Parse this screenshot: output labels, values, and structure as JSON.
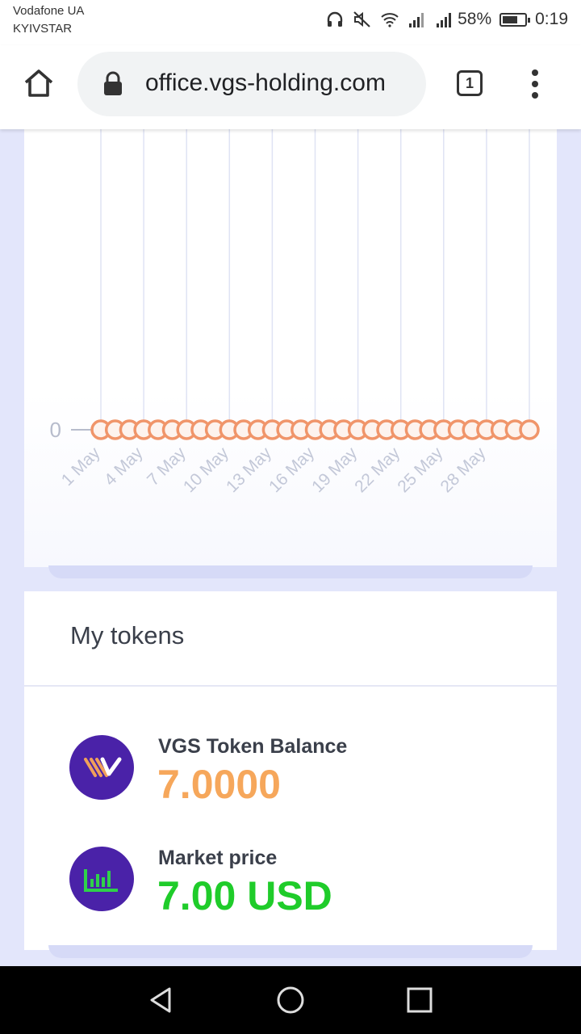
{
  "status_bar": {
    "carrier_primary": "Vodafone UA",
    "carrier_secondary": "KYIVSTAR",
    "battery": "58%",
    "time": "0:19"
  },
  "browser": {
    "url": "office.vgs-holding.com",
    "tab_count": "1"
  },
  "chart_data": {
    "type": "line",
    "x": [
      "1 May",
      "2 May",
      "3 May",
      "4 May",
      "5 May",
      "6 May",
      "7 May",
      "8 May",
      "9 May",
      "10 May",
      "11 May",
      "12 May",
      "13 May",
      "14 May",
      "15 May",
      "16 May",
      "17 May",
      "18 May",
      "19 May",
      "20 May",
      "21 May",
      "22 May",
      "23 May",
      "24 May",
      "25 May",
      "26 May",
      "27 May",
      "28 May",
      "29 May",
      "30 May",
      "31 May"
    ],
    "tick_labels": [
      "1 May",
      "4 May",
      "7 May",
      "10 May",
      "13 May",
      "16 May",
      "19 May",
      "22 May",
      "25 May",
      "28 May"
    ],
    "y_tick_labels": [
      "0"
    ],
    "series": [
      {
        "values": [
          0,
          0,
          0,
          0,
          0,
          0,
          0,
          0,
          0,
          0,
          0,
          0,
          0,
          0,
          0,
          0,
          0,
          0,
          0,
          0,
          0,
          0,
          0,
          0,
          0,
          0,
          0,
          0,
          0,
          0,
          0
        ]
      }
    ],
    "marker_color": "#f0956a",
    "grid": true
  },
  "tokens": {
    "title": "My tokens",
    "balance_label": "VGS Token Balance",
    "balance_value": "7.0000",
    "balance_color": "#f6a75b",
    "price_label": "Market price",
    "price_value": "7.00 USD",
    "price_color": "#1fcc2a",
    "icon_bg": "#4a22a8"
  }
}
